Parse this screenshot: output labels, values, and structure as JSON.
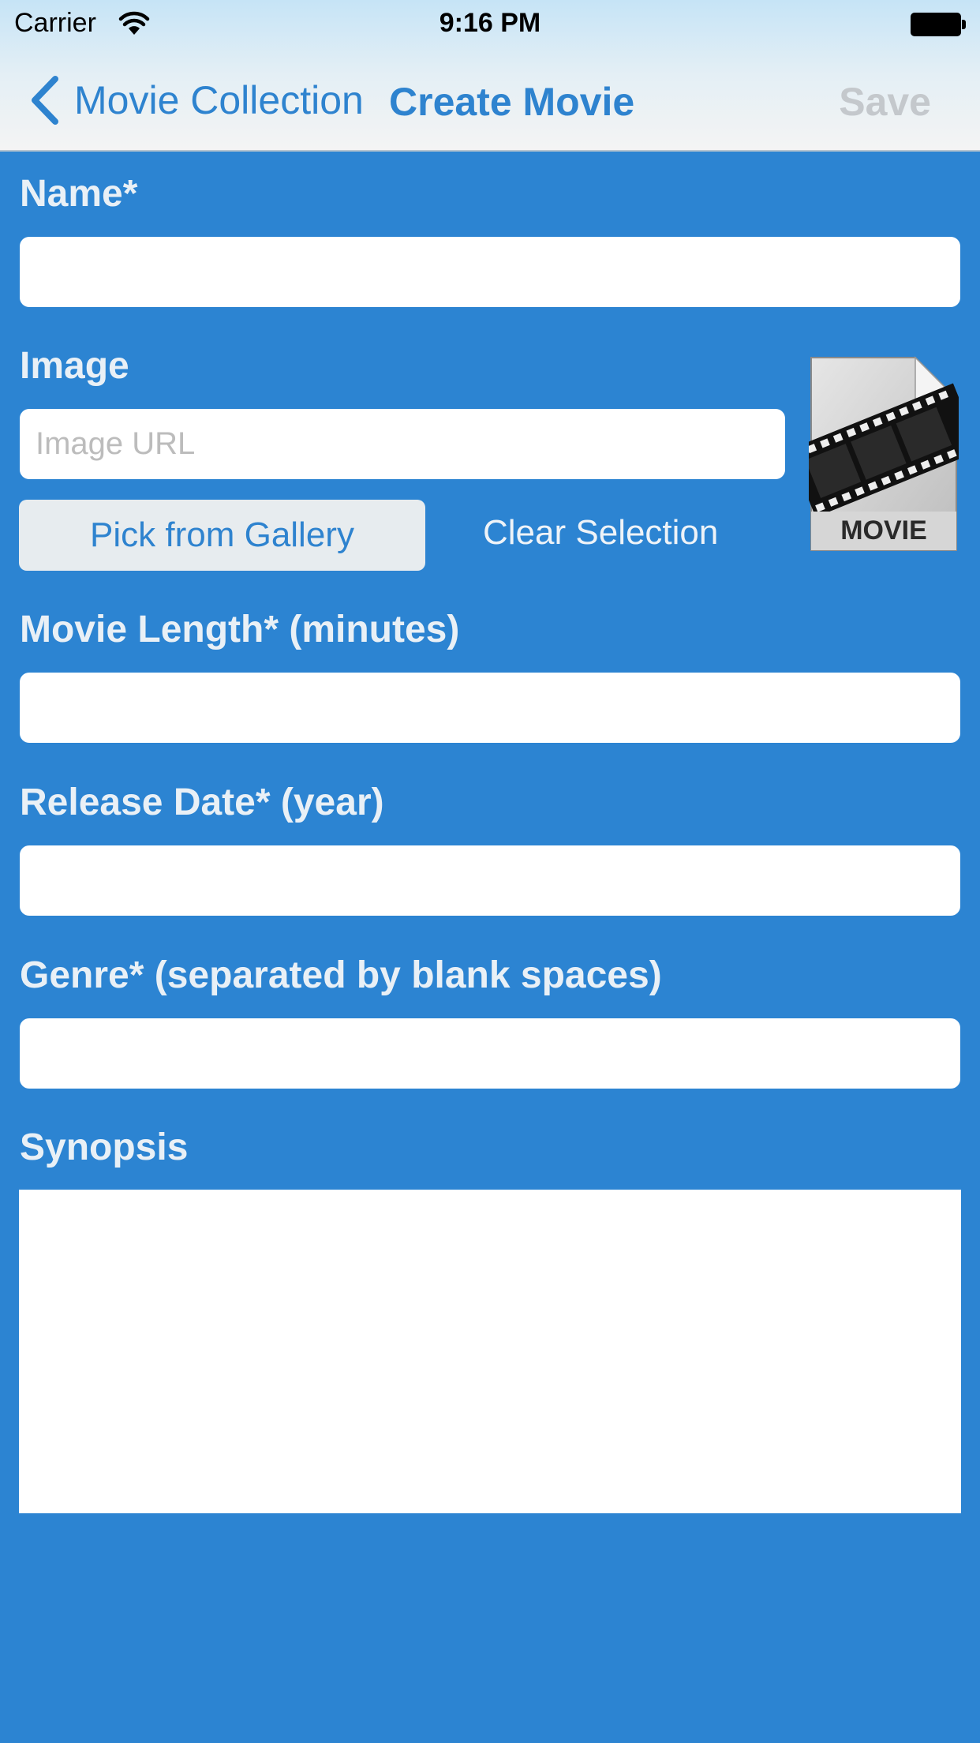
{
  "status_bar": {
    "carrier": "Carrier",
    "time": "9:16 PM"
  },
  "nav": {
    "back_label": "Movie Collection",
    "title": "Create Movie",
    "save_label": "Save"
  },
  "form": {
    "name_label": "Name*",
    "image_label": "Image",
    "image_url_placeholder": "Image URL",
    "pick_gallery_label": "Pick from Gallery",
    "clear_selection_label": "Clear Selection",
    "movie_image_text": "MOVIE",
    "length_label": "Movie Length* (minutes)",
    "release_label": "Release Date* (year)",
    "genre_label": "Genre* (separated by blank spaces)",
    "synopsis_label": "Synopsis"
  },
  "colors": {
    "background": "#2c84d2",
    "accent": "#2e83cf",
    "save_disabled": "#c4c8cc",
    "gallery_button_bg": "#e7ecef"
  },
  "icons": [
    "wifi-icon",
    "battery-icon",
    "chevron-left-icon",
    "movie-file-icon"
  ]
}
